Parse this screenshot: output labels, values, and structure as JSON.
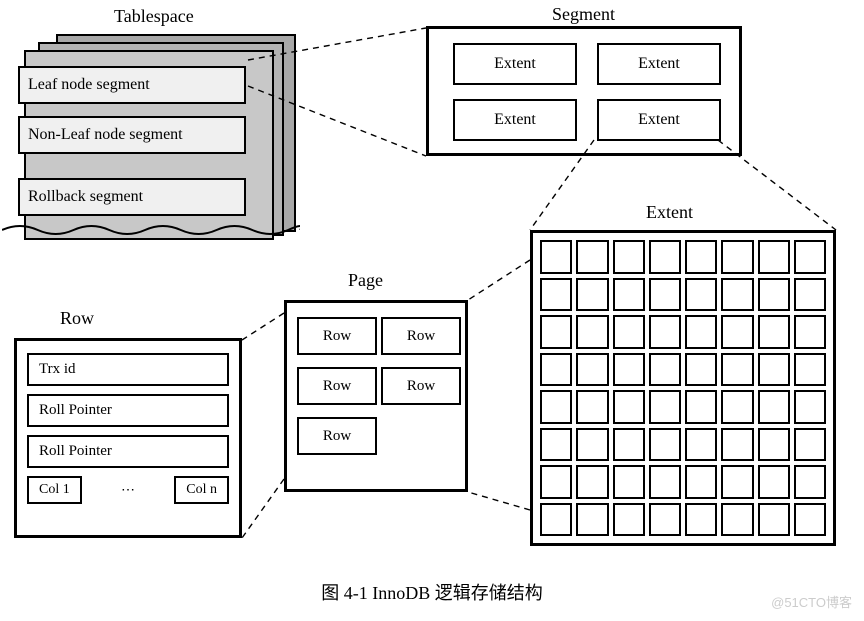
{
  "labels": {
    "tablespace": "Tablespace",
    "segment": "Segment",
    "extent": "Extent",
    "page": "Page",
    "row": "Row"
  },
  "tablespace": {
    "segments": [
      "Leaf node segment",
      "Non-Leaf node segment",
      "Rollback segment"
    ]
  },
  "segment": {
    "extents": [
      "Extent",
      "Extent",
      "Extent",
      "Extent"
    ]
  },
  "page": {
    "rows": [
      "Row",
      "Row",
      "Row",
      "Row",
      "Row"
    ]
  },
  "row": {
    "fields": [
      "Trx id",
      "Roll Pointer",
      "Roll Pointer"
    ],
    "col_first": "Col 1",
    "col_dots": "⋯",
    "col_last": "Col n"
  },
  "extent_grid": {
    "cols": 8,
    "rows": 8
  },
  "caption": "图 4-1    InnoDB 逻辑存储结构",
  "watermark": "@51CTO博客"
}
